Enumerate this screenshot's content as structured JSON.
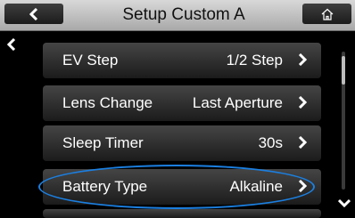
{
  "header": {
    "title": "Setup Custom A",
    "back_icon": "chevron-left-icon",
    "home_icon": "home-icon"
  },
  "menu": {
    "items": [
      {
        "label": "EV Step",
        "value": "1/2 Step"
      },
      {
        "label": "Lens Change",
        "value": "Last Aperture"
      },
      {
        "label": "Sleep Timer",
        "value": "30s"
      },
      {
        "label": "Battery Type",
        "value": "Alkaline"
      }
    ]
  },
  "highlight_color": "#1b7fe0"
}
